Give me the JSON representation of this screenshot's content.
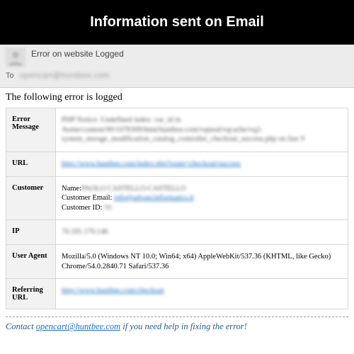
{
  "header": {
    "title": "Information sent on Email"
  },
  "email": {
    "subject": "Error on website Logged",
    "to_label": "To",
    "to_value": "opencart@huntbee.com"
  },
  "body": {
    "heading": "The following error is logged",
    "rows": {
      "error_message": {
        "label": "Error Message",
        "value": "PHP Notice: Undefined index: var_id in /home/content/00/1078309/html/huntbee.com/vqmod/vqcache/vq2-system_storage_modification_catalog_controller_checkout_success.php on line 9"
      },
      "url": {
        "label": "URL",
        "value": "http://www.huntbee.com/index.php?route=checkout/success"
      },
      "customer": {
        "label": "Customer",
        "name_label": "Name:",
        "name_value": "PAOLO CASTELLO-CASTELLO",
        "email_label": "Customer Email:",
        "email_value": "info@advancinformatics.it",
        "id_label": "Customer ID:",
        "id_value": "98"
      },
      "ip": {
        "label": "IP",
        "value": "70.181.170.146"
      },
      "user_agent": {
        "label": "User Agent",
        "value": "Mozilla/5.0 (Windows NT 10.0; Win64; x64) AppleWebKit/537.36 (KHTML, like Gecko) Chrome/54.0.2840.71 Safari/537.36"
      },
      "ref": {
        "label": "Referring URL",
        "value": "http://www.huntbee.com/checkout"
      }
    },
    "contact_prefix": "Contact ",
    "contact_email": "opencart@huntbee.com",
    "contact_suffix": " if you need help in fixing the error!"
  }
}
